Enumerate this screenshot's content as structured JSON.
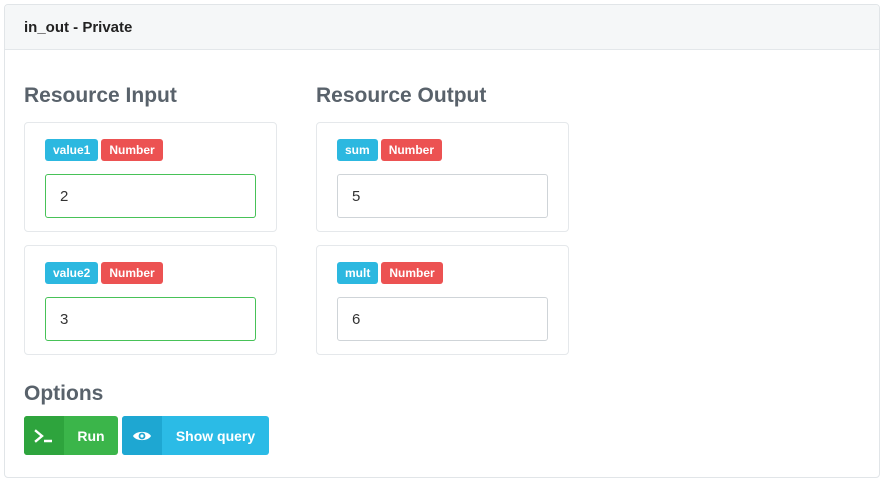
{
  "panel": {
    "title": "in_out - Private"
  },
  "input": {
    "title": "Resource Input",
    "items": [
      {
        "name": "value1",
        "type": "Number",
        "value": "2"
      },
      {
        "name": "value2",
        "type": "Number",
        "value": "3"
      }
    ]
  },
  "output": {
    "title": "Resource Output",
    "items": [
      {
        "name": "sum",
        "type": "Number",
        "value": "5"
      },
      {
        "name": "mult",
        "type": "Number",
        "value": "6"
      }
    ]
  },
  "options": {
    "title": "Options",
    "run_label": "Run",
    "run_icon": "terminal-icon",
    "query_label": "Show query",
    "query_icon": "eye-icon"
  },
  "colors": {
    "name_badge": "#2cb8e0",
    "type_badge": "#ec5252",
    "run": "#3bb54a",
    "query": "#2bbbe6",
    "valid_border": "#47c258"
  }
}
